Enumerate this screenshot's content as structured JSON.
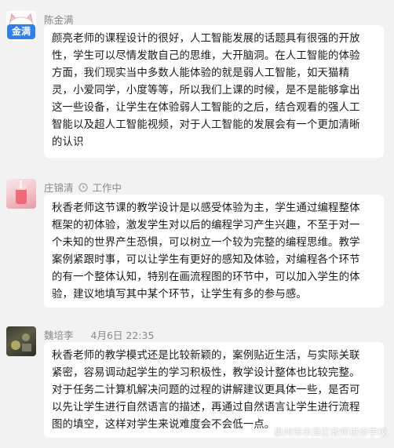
{
  "messages": [
    {
      "sender": "陈金满",
      "avatar_text": "金满",
      "lines": [
        "颜亮老师的课程设计的很好，人工智能发展的话题具有很强的开放",
        "性，学生可以尽情发散自己的思维，大开脑洞。在人工智能的体验",
        "方面，我们现实当中多数人能体验的就是弱人工智能，如天猫精",
        "灵，小爱同学，小度等等，所以我们上课的时候，是不是能够拿出",
        "这一些设备，让学生在体验弱人工智能的之后，结合观看的强人工",
        "智能以及超人工智能视频，对于人工智能的发展会有一个更加清晰",
        "的认识"
      ]
    },
    {
      "sender": "庄锦清",
      "status": "工作中",
      "lines": [
        "秋香老师这节课的教学设计是以感受体验为主，学生通过编程整体",
        "框架的初体验，激发学生对以后的编程学习产生兴趣，不至于对一",
        "个未知的世界产生恐惧，可以树立一个较为完整的编程思维。教学",
        "案例紧跟时事，可以让学生有更好的感知及体验，对编程各个环节",
        "的有一个整体认知，特别在画流程图的环节中，可以加入学生的体",
        "验，建议地填写其中某个环节，让学生有多的参与感。"
      ]
    },
    {
      "sender": "魏培李",
      "time": "4月6日 22:35",
      "lines": [
        "秋香老师的教学模式还是比较新颖的，案例贴近生活，与实际关联",
        "紧密，容易调动起学生的学习积极性，教学设计整体也比较完整。",
        "对于任务二计算机解决问题的过程的讲解建议更具体一些，是否可",
        "以先让学生进行自然语言的描述，再通过自然语言让学生进行流程",
        "图的填空，这样对学生来说难度会不会低一点。"
      ]
    }
  ],
  "watermark": {
    "text": "泉州市丰泽区教师进修学校",
    "icon": "wechat-channel-icon"
  },
  "colors": {
    "background": "#f2f2f2",
    "bubble": "#ffffff",
    "sender": "#8a8a8a",
    "badge": "#2d7ff0"
  }
}
